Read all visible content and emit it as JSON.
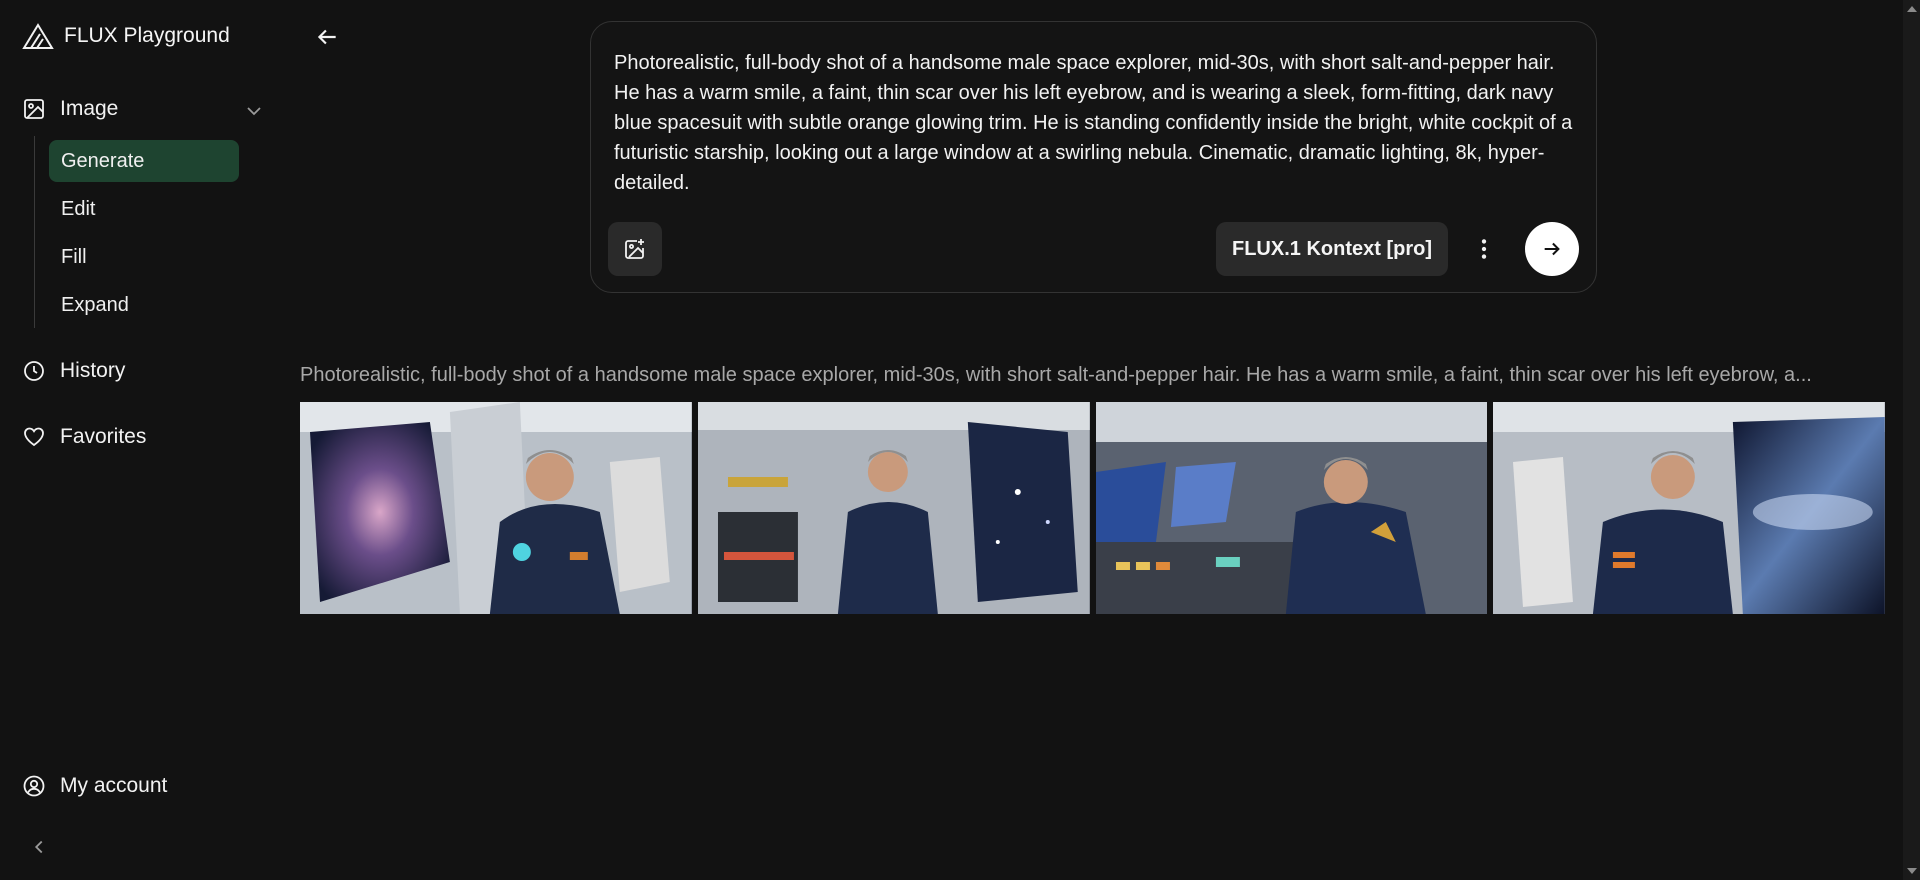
{
  "app": {
    "title": "FLUX Playground"
  },
  "sidebar": {
    "image_label": "Image",
    "subitems": [
      {
        "label": "Generate",
        "active": true
      },
      {
        "label": "Edit",
        "active": false
      },
      {
        "label": "Fill",
        "active": false
      },
      {
        "label": "Expand",
        "active": false
      }
    ],
    "history_label": "History",
    "favorites_label": "Favorites",
    "account_label": "My account"
  },
  "prompt": {
    "text": "Photorealistic, full-body shot of a handsome male space explorer, mid-30s, with short salt-and-pepper hair. He has a warm smile, a faint, thin scar over his left eyebrow, and is wearing a sleek, form-fitting, dark navy blue spacesuit with subtle orange glowing trim. He is standing confidently inside the bright, white cockpit of a futuristic starship, looking out a large window at a swirling nebula. Cinematic, dramatic lighting, 8k, hyper-detailed.",
    "model": "FLUX.1 Kontext [pro]"
  },
  "results": {
    "caption": "Photorealistic, full-body shot of a handsome male space explorer, mid-30s, with short salt-and-pepper hair. He has a warm smile, a faint, thin scar over his left eyebrow, a...",
    "images": [
      {
        "name": "result-image-1"
      },
      {
        "name": "result-image-2"
      },
      {
        "name": "result-image-3"
      },
      {
        "name": "result-image-4"
      }
    ]
  },
  "colors": {
    "background": "#121212",
    "active_nav": "#1e4430",
    "card_border": "#333333",
    "button_bg": "#2a2a2a"
  }
}
